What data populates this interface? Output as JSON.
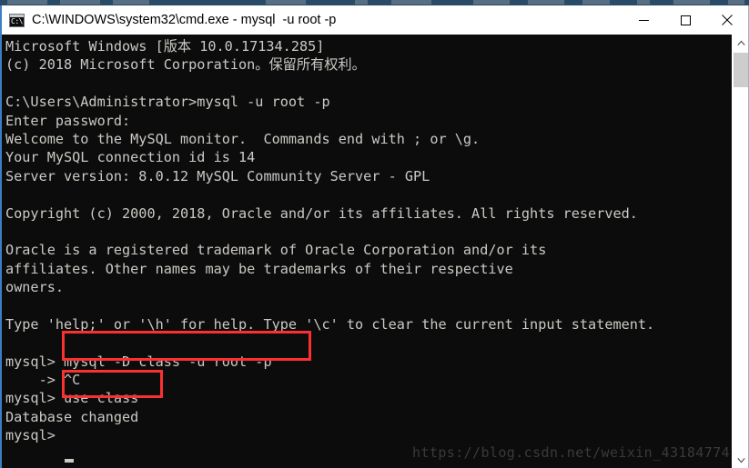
{
  "window": {
    "title": "C:\\WINDOWS\\system32\\cmd.exe - mysql  -u root -p",
    "icon": "cmd-icon",
    "icon_text": "C:\\",
    "controls": {
      "minimize": "Minimize",
      "maximize": "Maximize",
      "close": "Close"
    }
  },
  "console": {
    "prompt_symbol": "mysql>",
    "cursor": "_",
    "lines": [
      "Microsoft Windows [版本 10.0.17134.285]",
      "(c) 2018 Microsoft Corporation。保留所有权利。",
      "",
      "C:\\Users\\Administrator>mysql -u root -p",
      "Enter password:",
      "Welcome to the MySQL monitor.  Commands end with ; or \\g.",
      "Your MySQL connection id is 14",
      "Server version: 8.0.12 MySQL Community Server - GPL",
      "",
      "Copyright (c) 2000, 2018, Oracle and/or its affiliates. All rights reserved.",
      "",
      "Oracle is a registered trademark of Oracle Corporation and/or its",
      "affiliates. Other names may be trademarks of their respective",
      "owners.",
      "",
      "Type 'help;' or '\\h' for help. Type '\\c' to clear the current input statement.",
      "",
      "mysql> mysql -D class -u root -p",
      "    -> ^C",
      "mysql> use class",
      "Database changed",
      "mysql> "
    ]
  },
  "annotations": {
    "box_1_text": "mysql -D class -u root -p",
    "box_2_text": "use class",
    "color": "#fc3030"
  },
  "watermark": {
    "text": "https://blog.csdn.net/weixin_43184774"
  },
  "scrollbar": {
    "up_arrow": "scroll-up-icon",
    "down_arrow": "scroll-down-icon"
  }
}
